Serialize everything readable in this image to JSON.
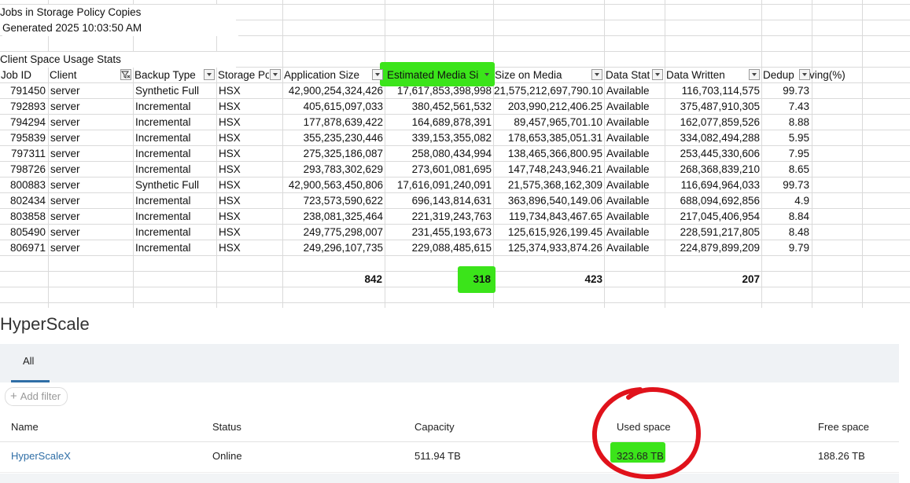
{
  "sheet": {
    "title": "Jobs in Storage Policy Copies",
    "generated": "Generated: 2025 10:03:50 AM",
    "generated_visible": " Generated 2025 10:03:50 AM",
    "section": "Client Space Usage Stats",
    "headers": [
      "Job ID",
      "Client",
      "Backup Type",
      "Storage Po",
      "Application Size",
      "Estimated Media Si",
      "Size on Media",
      "Data Stat",
      "Data Written",
      "Dedup",
      "ving(%)"
    ],
    "rows": [
      [
        "791450",
        "server",
        "Synthetic Full",
        "HSX",
        "42,900,254,324,426",
        "17,617,853,398,998",
        "21,575,212,697,790.10",
        "Available",
        "116,703,114,575",
        "99.73"
      ],
      [
        "792893",
        "server",
        "Incremental",
        "HSX",
        "405,615,097,033",
        "380,452,561,532",
        "203,990,212,406.25",
        "Available",
        "375,487,910,305",
        "7.43"
      ],
      [
        "794294",
        "server",
        "Incremental",
        "HSX",
        "177,878,639,422",
        "164,689,878,391",
        "89,457,965,701.10",
        "Available",
        "162,077,859,526",
        "8.88"
      ],
      [
        "795839",
        "server",
        "Incremental",
        "HSX",
        "355,235,230,446",
        "339,153,355,082",
        "178,653,385,051.31",
        "Available",
        "334,082,494,288",
        "5.95"
      ],
      [
        "797311",
        "server",
        "Incremental",
        "HSX",
        "275,325,186,087",
        "258,080,434,994",
        "138,465,366,800.95",
        "Available",
        "253,445,330,606",
        "7.95"
      ],
      [
        "798726",
        "server",
        "Incremental",
        "HSX",
        "293,783,302,629",
        "273,601,081,695",
        "147,748,243,946.21",
        "Available",
        "268,368,839,210",
        "8.65"
      ],
      [
        "800883",
        "server",
        "Synthetic Full",
        "HSX",
        "42,900,563,450,806",
        "17,616,091,240,091",
        "21,575,368,162,309",
        "Available",
        "116,694,964,033",
        "99.73"
      ],
      [
        "802434",
        "server",
        "Incremental",
        "HSX",
        "723,573,590,622",
        "696,143,814,631",
        "363,896,540,149.06",
        "Available",
        "688,094,692,856",
        "4.9"
      ],
      [
        "803858",
        "server",
        "Incremental",
        "HSX",
        "238,081,325,464",
        "221,319,243,763",
        "119,734,843,467.65",
        "Available",
        "217,045,406,954",
        "8.84"
      ],
      [
        "805490",
        "server",
        "Incremental",
        "HSX",
        "249,775,298,007",
        "231,455,193,673",
        "125,615,926,199.45",
        "Available",
        "228,591,217,805",
        "8.48"
      ],
      [
        "806971",
        "server",
        "Incremental",
        "HSX",
        "249,296,107,735",
        "229,088,485,615",
        "125,374,933,874.26",
        "Available",
        "224,879,899,209",
        "9.79"
      ]
    ],
    "totals": {
      "application_size": "842",
      "estimated_media": "318",
      "size_on_media": "423",
      "data_written": "207"
    },
    "highlight_color": "#3be41a"
  },
  "hyperscale": {
    "title": "HyperScale",
    "tab": "All",
    "add_filter": "Add filter",
    "columns": [
      "Name",
      "Status",
      "Capacity",
      "Used space",
      "Free space"
    ],
    "row": {
      "name": "HyperScaleX",
      "status": "Online",
      "capacity": "511.94 TB",
      "used": "323.68 TB",
      "free": "188.26 TB"
    },
    "accent_color": "#2f6ea6",
    "annotation_color": "#e0121b"
  }
}
